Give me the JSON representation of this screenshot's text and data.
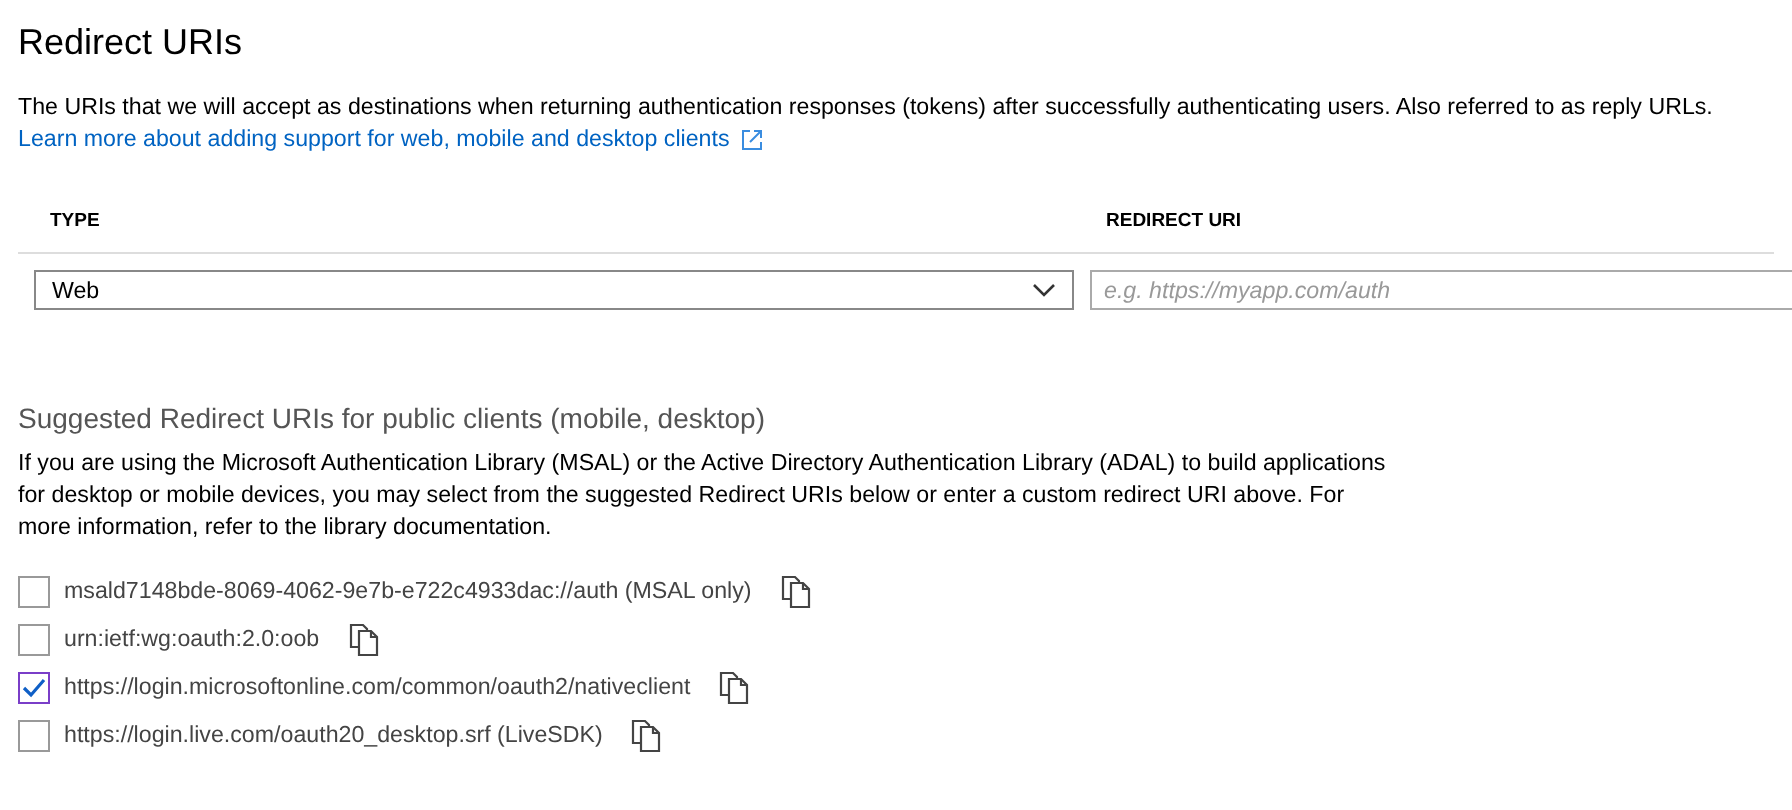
{
  "title": "Redirect URIs",
  "description": "The URIs that we will accept as destinations when returning authentication responses (tokens) after successfully authenticating users. Also referred to as reply URLs.",
  "learn_more_link": "Learn more about adding support for web, mobile and desktop clients",
  "table": {
    "columns": [
      "TYPE",
      "REDIRECT URI"
    ],
    "rows": [
      {
        "type": "Web",
        "redirect_uri_placeholder": "e.g. https://myapp.com/auth"
      }
    ]
  },
  "suggested": {
    "heading": "Suggested Redirect URIs for public clients (mobile, desktop)",
    "text": "If you are using the Microsoft Authentication Library (MSAL) or the Active Directory Authentication Library (ADAL) to build applications for desktop or mobile devices, you may select from the suggested Redirect URIs below or enter a custom redirect URI above. For more information, refer to the library documentation.",
    "items": [
      {
        "label": "msald7148bde-8069-4062-9e7b-e722c4933dac://auth (MSAL only)",
        "checked": false
      },
      {
        "label": "urn:ietf:wg:oauth:2.0:oob",
        "checked": false
      },
      {
        "label": "https://login.microsoftonline.com/common/oauth2/nativeclient",
        "checked": true
      },
      {
        "label": "https://login.live.com/oauth20_desktop.srf (LiveSDK)",
        "checked": false
      }
    ]
  }
}
